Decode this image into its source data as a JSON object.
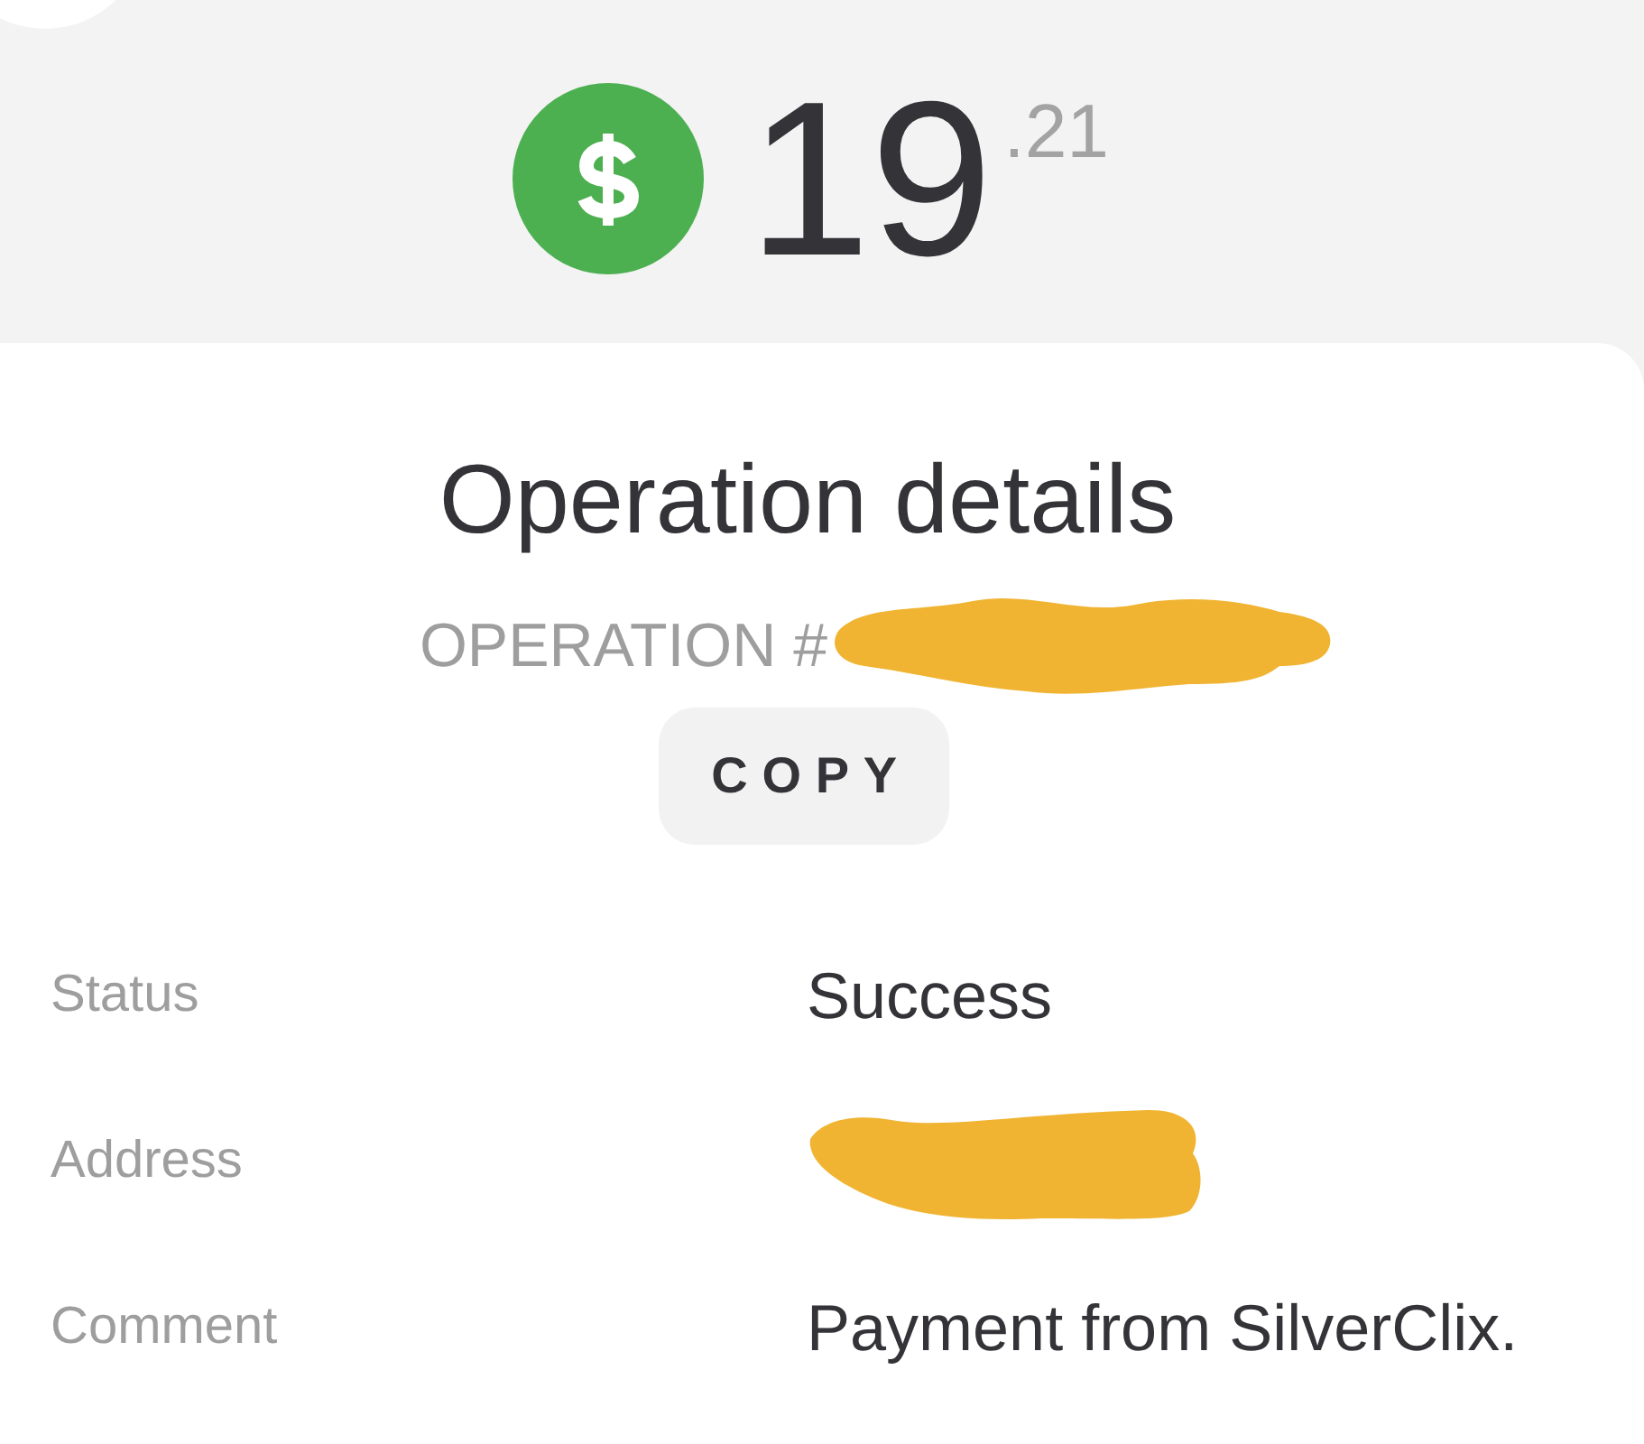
{
  "amount": {
    "whole": "19",
    "fraction": ".21"
  },
  "details": {
    "title": "Operation details",
    "operation": {
      "label": "OPERATION #",
      "redacted": true
    },
    "copy_button": "COPY",
    "rows": [
      {
        "label": "Status",
        "value": "Success"
      },
      {
        "label": "Address",
        "redacted": true
      },
      {
        "label": "Comment",
        "value": "Payment from SilverClix."
      }
    ]
  }
}
